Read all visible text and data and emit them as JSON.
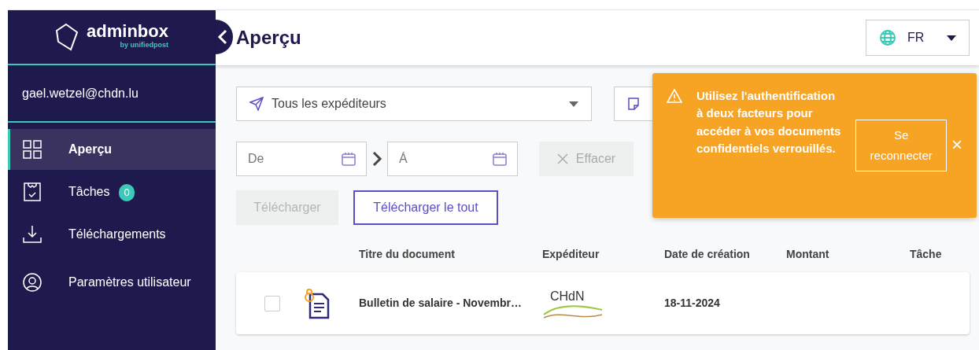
{
  "brand": {
    "name": "adminbox",
    "tagline": "by unifiedpost"
  },
  "user": {
    "email": "gael.wetzel@chdn.lu"
  },
  "sidebar": {
    "items": [
      {
        "kind": "overview",
        "label": "Aperçu",
        "selected": true
      },
      {
        "kind": "tasks",
        "label": "Tâches",
        "selected": false,
        "badge": "0"
      },
      {
        "kind": "downloads",
        "label": "Téléchargements",
        "selected": false
      },
      {
        "kind": "settings",
        "label": "Paramètres utilisateur",
        "selected": false
      }
    ]
  },
  "header": {
    "title": "Aperçu",
    "language": "FR"
  },
  "filters": {
    "sender": "Tous les expéditeurs",
    "from_placeholder": "De",
    "to_placeholder": "Á",
    "clear": "Effacer"
  },
  "actions": [
    {
      "label": "Télécharger",
      "disabled": true
    },
    {
      "label": "Télécharger le tout",
      "disabled": false
    }
  ],
  "table": {
    "columns": [
      "Titre du document",
      "Expéditeur",
      "Date de création",
      "Montant",
      "Tâche"
    ],
    "rows": [
      {
        "checked": false,
        "title": "Bulletin de salaire - Novembr…",
        "sender_logo": "CHdN",
        "date": "18-11-2024"
      }
    ]
  },
  "toast": {
    "message": "Utilisez l'authentification à deux facteurs pour accéder à vos documents confidentiels verrouillés.",
    "button": "Se reconnecter",
    "close": "×"
  }
}
